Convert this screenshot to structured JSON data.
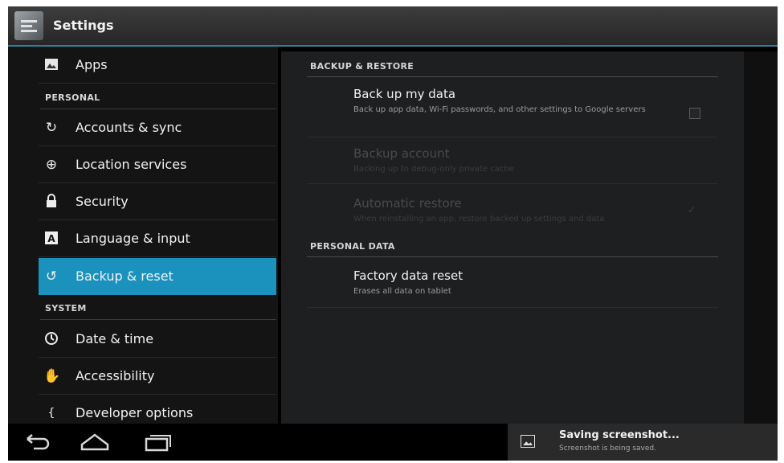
{
  "action_bar": {
    "title": "Settings",
    "icon": "settings-app-icon"
  },
  "sidebar": {
    "items": [
      {
        "label": "Apps",
        "icon": "apps-icon"
      },
      {
        "header": "PERSONAL"
      },
      {
        "label": "Accounts & sync",
        "icon": "sync-icon"
      },
      {
        "label": "Location services",
        "icon": "location-icon"
      },
      {
        "label": "Security",
        "icon": "lock-icon"
      },
      {
        "label": "Language & input",
        "icon": "language-icon"
      },
      {
        "label": "Backup & reset",
        "icon": "backup-icon",
        "selected": true
      },
      {
        "header": "SYSTEM"
      },
      {
        "label": "Date & time",
        "icon": "clock-icon"
      },
      {
        "label": "Accessibility",
        "icon": "hand-icon"
      },
      {
        "label": "Developer options",
        "icon": "braces-icon"
      }
    ]
  },
  "content": {
    "backup_section": "BACKUP & RESTORE",
    "backup_my_data": {
      "title": "Back up my data",
      "summary": "Back up app data, Wi-Fi passwords, and other settings to Google servers",
      "checked": false
    },
    "backup_account": {
      "title": "Backup account",
      "summary": "Backing up to debug-only private cache",
      "enabled": false
    },
    "automatic_restore": {
      "title": "Automatic restore",
      "summary": "When reinstalling an app, restore backed up settings and data",
      "enabled": false,
      "checked": true
    },
    "personal_section": "PERSONAL DATA",
    "factory_reset": {
      "title": "Factory data reset",
      "summary": "Erases all data on tablet"
    }
  },
  "system_bar": {
    "nav": [
      "back-icon",
      "home-icon",
      "recent-apps-icon"
    ],
    "notification": {
      "title": "Saving screenshot...",
      "text": "Screenshot is being saved.",
      "icon": "image-icon"
    }
  },
  "colors": {
    "accent": "#1a92bd",
    "background": "#000000",
    "pane": "#1e1f20"
  }
}
